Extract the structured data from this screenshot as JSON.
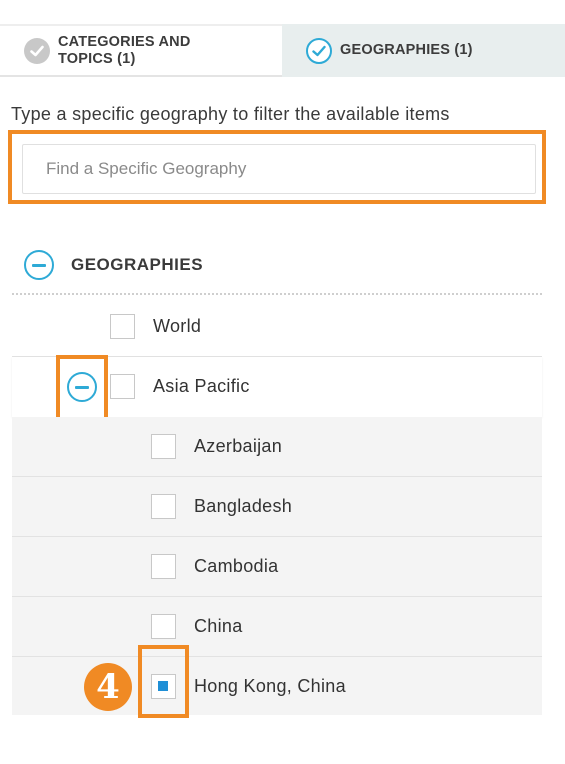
{
  "tabs": [
    {
      "label": "CATEGORIES AND\nTOPICS (1)",
      "state": "done"
    },
    {
      "label": "GEOGRAPHIES (1)",
      "state": "active"
    }
  ],
  "instructions": "Type a specific geography to filter the available items",
  "search": {
    "placeholder": "Find a Specific Geography",
    "value": ""
  },
  "group": {
    "title": "GEOGRAPHIES",
    "expanded": true
  },
  "tree": {
    "world": {
      "label": "World",
      "checked": false
    },
    "asia_pacific": {
      "label": "Asia Pacific",
      "checked": false,
      "expanded": true
    },
    "children": [
      {
        "label": "Azerbaijan",
        "checked": false
      },
      {
        "label": "Bangladesh",
        "checked": false
      },
      {
        "label": "Cambodia",
        "checked": false
      },
      {
        "label": "China",
        "checked": false
      },
      {
        "label": "Hong Kong, China",
        "checked": true
      }
    ]
  },
  "annotation": {
    "step": "4"
  },
  "colors": {
    "accent": "#2eaad6",
    "highlight": "#f08a24",
    "checked": "#1f8fd6"
  }
}
